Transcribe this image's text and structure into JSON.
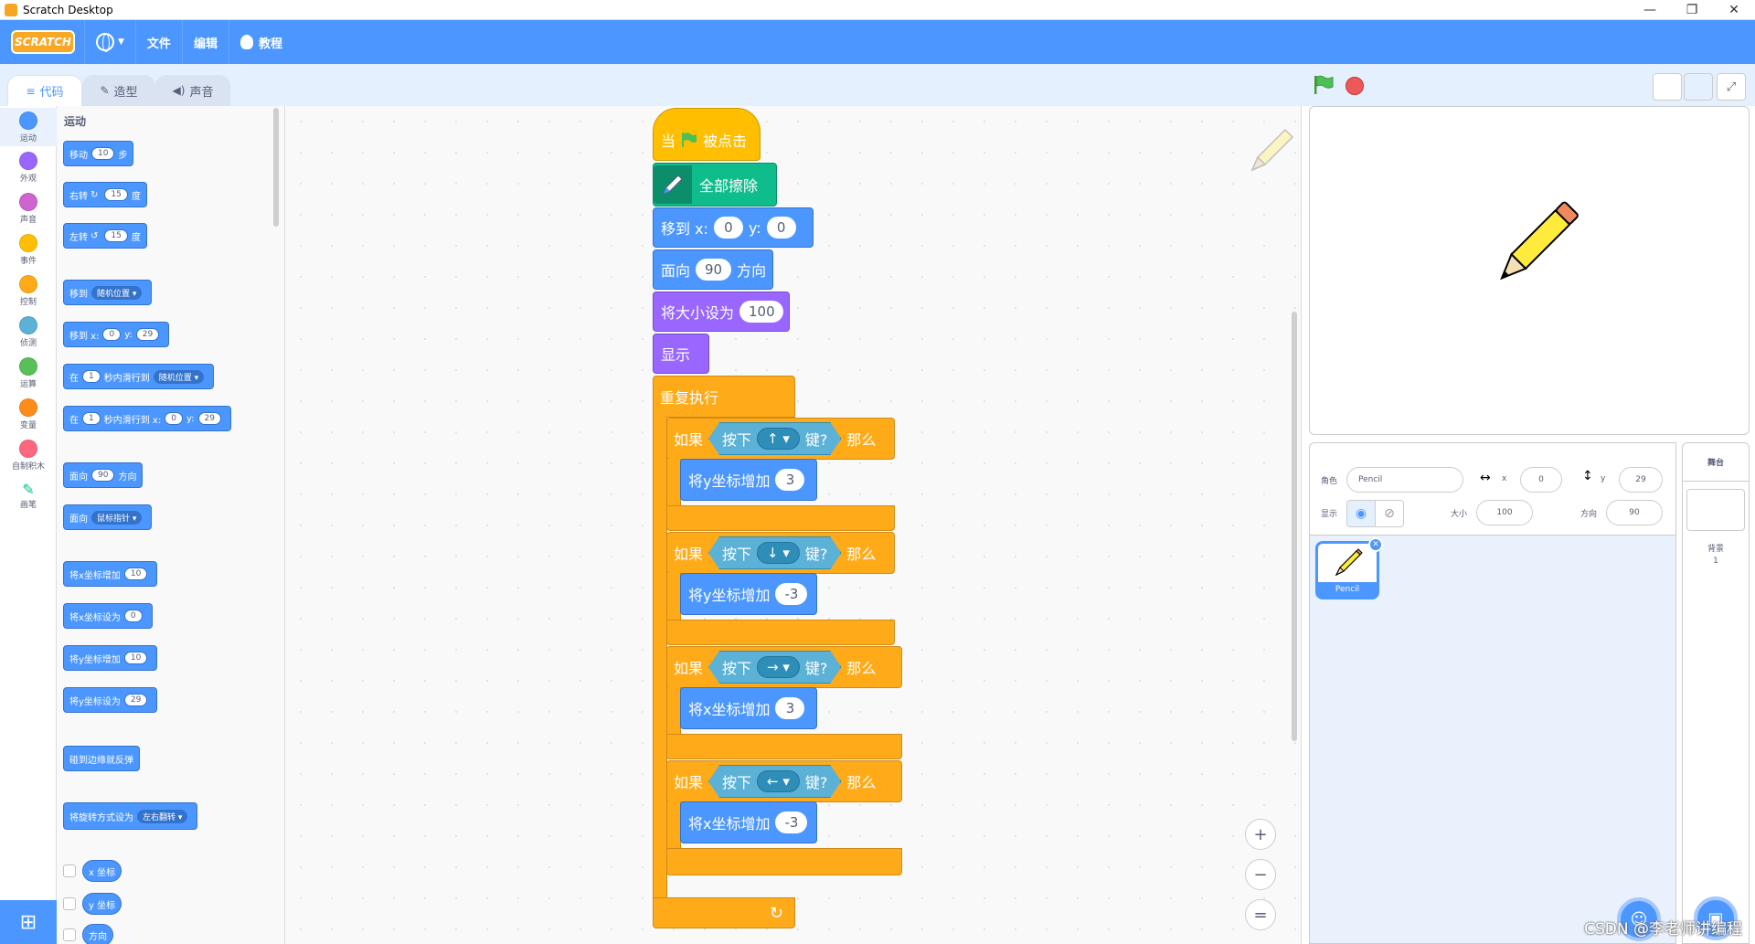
{
  "window": {
    "title": "Scratch Desktop",
    "minimize": "—",
    "restore": "❐",
    "close": "✕"
  },
  "menubar": {
    "logo": "SCRATCH",
    "file": "文件",
    "edit": "编辑",
    "tutorials": "教程"
  },
  "tabs": {
    "code": "代码",
    "costumes": "造型",
    "sounds": "声音"
  },
  "categories": [
    {
      "label": "运动",
      "color": "#4c97ff"
    },
    {
      "label": "外观",
      "color": "#9966ff"
    },
    {
      "label": "声音",
      "color": "#cf63cf"
    },
    {
      "label": "事件",
      "color": "#ffbf00"
    },
    {
      "label": "控制",
      "color": "#ffab19"
    },
    {
      "label": "侦测",
      "color": "#5cb1d6"
    },
    {
      "label": "运算",
      "color": "#59c059"
    },
    {
      "label": "变量",
      "color": "#ff8c1a"
    },
    {
      "label": "自制积木",
      "color": "#ff6680"
    },
    {
      "label": "画笔",
      "color": "#0fbd8c"
    }
  ],
  "palette": {
    "title": "运动",
    "move": [
      "移动",
      "10",
      "步"
    ],
    "turn_right": [
      "右转",
      "15",
      "度"
    ],
    "turn_left": [
      "左转",
      "15",
      "度"
    ],
    "goto": [
      "移到",
      "随机位置"
    ],
    "goto_xy": [
      "移到 x:",
      "0",
      "y:",
      "29"
    ],
    "glide_to": [
      "在",
      "1",
      "秒内滑行到",
      "随机位置"
    ],
    "glide_xy": [
      "在",
      "1",
      "秒内滑行到 x:",
      "0",
      "y:",
      "29"
    ],
    "point_dir": [
      "面向",
      "90",
      "方向"
    ],
    "point_towards": [
      "面向",
      "鼠标指针"
    ],
    "change_x": [
      "将x坐标增加",
      "10"
    ],
    "set_x": [
      "将x坐标设为",
      "0"
    ],
    "change_y": [
      "将y坐标增加",
      "10"
    ],
    "set_y": [
      "将y坐标设为",
      "29"
    ],
    "bounce": "碰到边缘就反弹",
    "rotation_style": [
      "将旋转方式设为",
      "左右翻转"
    ],
    "x_position": "x 坐标",
    "y_position": "y 坐标",
    "direction": "方向"
  },
  "script": {
    "hat": [
      "当",
      "被点击"
    ],
    "clear": "全部擦除",
    "goto_xy": [
      "移到 x:",
      "0",
      "y:",
      "0"
    ],
    "point_dir": [
      "面向",
      "90",
      "方向"
    ],
    "set_size": [
      "将大小设为",
      "100"
    ],
    "show": "显示",
    "forever": "重复执行",
    "if_blocks": [
      {
        "if": "如果",
        "press": "按下",
        "key": "↑",
        "key_q": "键?",
        "then": "那么",
        "action": "将y坐标增加",
        "value": "3"
      },
      {
        "if": "如果",
        "press": "按下",
        "key": "↓",
        "key_q": "键?",
        "then": "那么",
        "action": "将y坐标增加",
        "value": "-3"
      },
      {
        "if": "如果",
        "press": "按下",
        "key": "→",
        "key_q": "键?",
        "then": "那么",
        "action": "将x坐标增加",
        "value": "3"
      },
      {
        "if": "如果",
        "press": "按下",
        "key": "←",
        "key_q": "键?",
        "then": "那么",
        "action": "将x坐标增加",
        "value": "-3"
      }
    ],
    "loop_arrow": "↻"
  },
  "zoom": {
    "in": "+",
    "out": "−",
    "reset": "="
  },
  "sprite_info": {
    "sprite_label": "角色",
    "sprite_name": "Pencil",
    "x_label": "x",
    "x_value": "0",
    "y_label": "y",
    "y_value": "29",
    "show_label": "显示",
    "size_label": "大小",
    "size_value": "100",
    "direction_label": "方向",
    "direction_value": "90"
  },
  "sprites": [
    {
      "name": "Pencil"
    }
  ],
  "stage_pane": {
    "title": "舞台",
    "backdrops_label": "背景",
    "backdrops_count": "1"
  },
  "watermark": "CSDN @李老师讲编程",
  "colors": {
    "accent": "#4c97ff",
    "motion": "#4c97ff",
    "control": "#ffab19",
    "pen": "#0fbd8c",
    "looks": "#9966ff",
    "events": "#ffbf00",
    "sensing": "#5cb1d6"
  }
}
